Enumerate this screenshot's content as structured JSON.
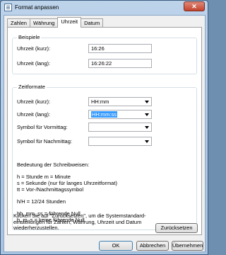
{
  "window": {
    "title": "Format anpassen",
    "close_label": "✕"
  },
  "tabs": [
    "Zahlen",
    "Währung",
    "Uhrzeit",
    "Datum"
  ],
  "examples": {
    "group_title": "Beispiele",
    "short_label": "Uhrzeit (kurz):",
    "short_value": "16:26",
    "long_label": "Uhrzeit (lang):",
    "long_value": "16:26:22"
  },
  "formats": {
    "group_title": "Zeitformate",
    "short_label": "Uhrzeit (kurz):",
    "short_value": "HH:mm",
    "long_label": "Uhrzeit (lang):",
    "long_value": "HH:mm:ss",
    "am_label": "Symbol für Vormittag:",
    "am_value": "",
    "pm_label": "Symbol für Nachmittag:",
    "pm_value": ""
  },
  "notes": {
    "heading": "Bedeutung der Schreibweisen:",
    "line1": "h = Stunde    m = Minute",
    "line2": "s = Sekunde (nur für langes Uhrzeitformat)",
    "line3": "tt = Vor-/Nachmittagssymbol",
    "line4": "h/H = 12/24 Stunden",
    "line5": "hh, mm, ss = führende Null",
    "line6": "h, m, s = keine führende Null"
  },
  "reset": {
    "text1": "Klicken Sie auf \"Zurücksetzen\", um die Systemstandard-",
    "text2": "einstellungen für Zahlen, Währung, Uhrzeit und Datum",
    "text3": "wiederherzustellen.",
    "button": "Zurücksetzen"
  },
  "buttons": {
    "ok": "OK",
    "cancel": "Abbrechen",
    "apply": "Übernehmen"
  }
}
